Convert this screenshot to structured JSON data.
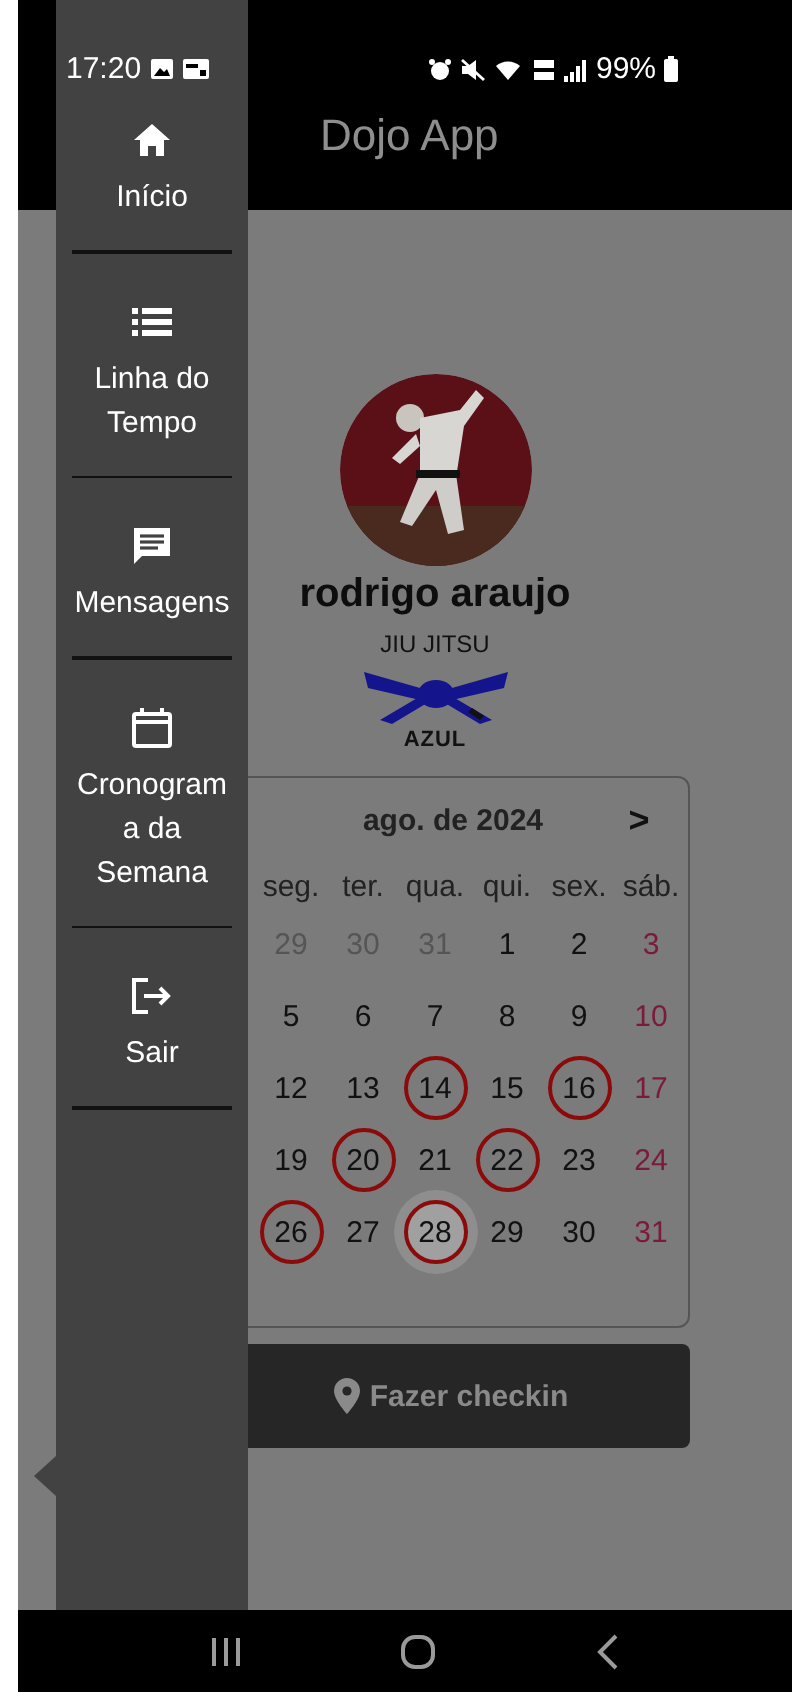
{
  "status_bar": {
    "time": "17:20",
    "battery": "99%"
  },
  "app_bar": {
    "title": "Dojo App"
  },
  "drawer": {
    "items": [
      {
        "label": "Início"
      },
      {
        "label": "Linha do Tempo"
      },
      {
        "label": "Mensagens"
      },
      {
        "label": "Cronograma da Semana"
      },
      {
        "label": "Sair"
      }
    ]
  },
  "profile": {
    "name": "rodrigo araujo",
    "martial_art": "JIU JITSU",
    "belt": "AZUL"
  },
  "calendar": {
    "month": "ago. de 2024",
    "next": ">",
    "weekdays": [
      "seg.",
      "ter.",
      "qua.",
      "qui.",
      "sex.",
      "sáb."
    ],
    "weeks": [
      [
        {
          "day": "29",
          "outside": true,
          "marked": false,
          "today": false
        },
        {
          "day": "30",
          "outside": true,
          "marked": false,
          "today": false
        },
        {
          "day": "31",
          "outside": true,
          "marked": false,
          "today": false
        },
        {
          "day": "1",
          "outside": false,
          "marked": false,
          "today": false
        },
        {
          "day": "2",
          "outside": false,
          "marked": false,
          "today": false
        },
        {
          "day": "3",
          "outside": false,
          "marked": false,
          "today": false
        }
      ],
      [
        {
          "day": "5",
          "outside": false,
          "marked": false,
          "today": false
        },
        {
          "day": "6",
          "outside": false,
          "marked": false,
          "today": false
        },
        {
          "day": "7",
          "outside": false,
          "marked": false,
          "today": false
        },
        {
          "day": "8",
          "outside": false,
          "marked": false,
          "today": false
        },
        {
          "day": "9",
          "outside": false,
          "marked": false,
          "today": false
        },
        {
          "day": "10",
          "outside": false,
          "marked": false,
          "today": false
        }
      ],
      [
        {
          "day": "12",
          "outside": false,
          "marked": false,
          "today": false
        },
        {
          "day": "13",
          "outside": false,
          "marked": false,
          "today": false
        },
        {
          "day": "14",
          "outside": false,
          "marked": true,
          "today": false
        },
        {
          "day": "15",
          "outside": false,
          "marked": false,
          "today": false
        },
        {
          "day": "16",
          "outside": false,
          "marked": true,
          "today": false
        },
        {
          "day": "17",
          "outside": false,
          "marked": false,
          "today": false
        }
      ],
      [
        {
          "day": "19",
          "outside": false,
          "marked": false,
          "today": false
        },
        {
          "day": "20",
          "outside": false,
          "marked": true,
          "today": false
        },
        {
          "day": "21",
          "outside": false,
          "marked": false,
          "today": false
        },
        {
          "day": "22",
          "outside": false,
          "marked": true,
          "today": false
        },
        {
          "day": "23",
          "outside": false,
          "marked": false,
          "today": false
        },
        {
          "day": "24",
          "outside": false,
          "marked": false,
          "today": false
        }
      ],
      [
        {
          "day": "26",
          "outside": false,
          "marked": true,
          "today": false
        },
        {
          "day": "27",
          "outside": false,
          "marked": false,
          "today": false
        },
        {
          "day": "28",
          "outside": false,
          "marked": true,
          "today": true
        },
        {
          "day": "29",
          "outside": false,
          "marked": false,
          "today": false
        },
        {
          "day": "30",
          "outside": false,
          "marked": false,
          "today": false
        },
        {
          "day": "31",
          "outside": false,
          "marked": false,
          "today": false
        }
      ]
    ]
  },
  "checkin_button": {
    "label": "Fazer checkin"
  }
}
